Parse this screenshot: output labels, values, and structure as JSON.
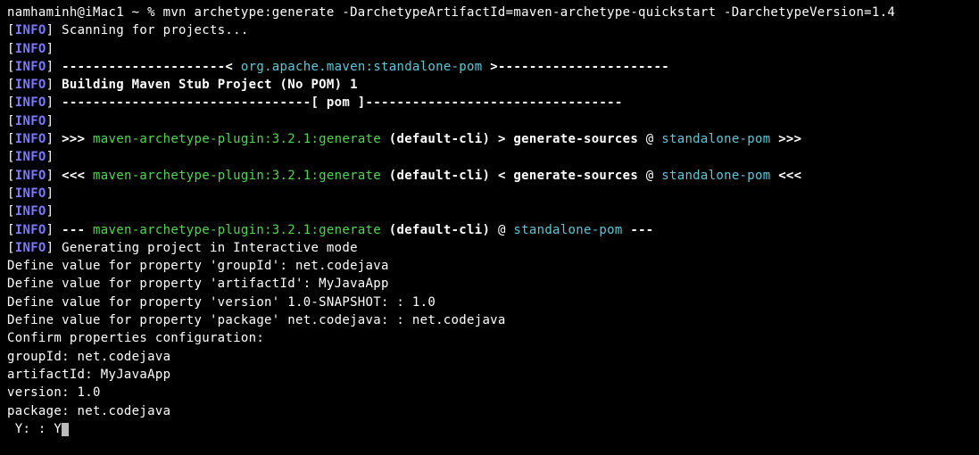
{
  "prompt": {
    "user_host": "namhaminh@iMac1",
    "path": " ~ % ",
    "command": "mvn archetype:generate -DarchetypeArtifactId=maven-archetype-quickstart -DarchetypeVersion=1.4"
  },
  "lines": {
    "bracket_open": "[",
    "bracket_close": "]",
    "info": "INFO",
    "scanning": " Scanning for projects...",
    "empty": "",
    "sep_left": " ---------------------< ",
    "sep_artifact": "org.apache.maven:standalone-pom",
    "sep_right": " >----------------------",
    "building": " Building Maven Stub Project (No POM) 1",
    "pom_sep": " --------------------------------[ pom ]---------------------------------",
    "arrow_fwd": " >>> ",
    "arrow_back": " <<< ",
    "dash3": " --- ",
    "plugin": "maven-archetype-plugin:3.2.1:generate",
    "default_cli": " (default-cli)",
    "gt": " > ",
    "lt": " < ",
    "at": " @ ",
    "gensources": "generate-sources",
    "standalone": "standalone-pom",
    "fwd_end": " >>>",
    "back_end": " <<<",
    "dash_end": " ---",
    "generating": " Generating project in Interactive mode",
    "def_groupid": "Define value for property 'groupId': net.codejava",
    "def_artifactid": "Define value for property 'artifactId': MyJavaApp",
    "def_version": "Define value for property 'version' 1.0-SNAPSHOT: : 1.0",
    "def_package": "Define value for property 'package' net.codejava: : net.codejava",
    "confirm": "Confirm properties configuration:",
    "groupid": "groupId: net.codejava",
    "artifactid": "artifactId: MyJavaApp",
    "version": "version: 1.0",
    "package": "package: net.codejava",
    "y_prompt": " Y: : Y"
  }
}
